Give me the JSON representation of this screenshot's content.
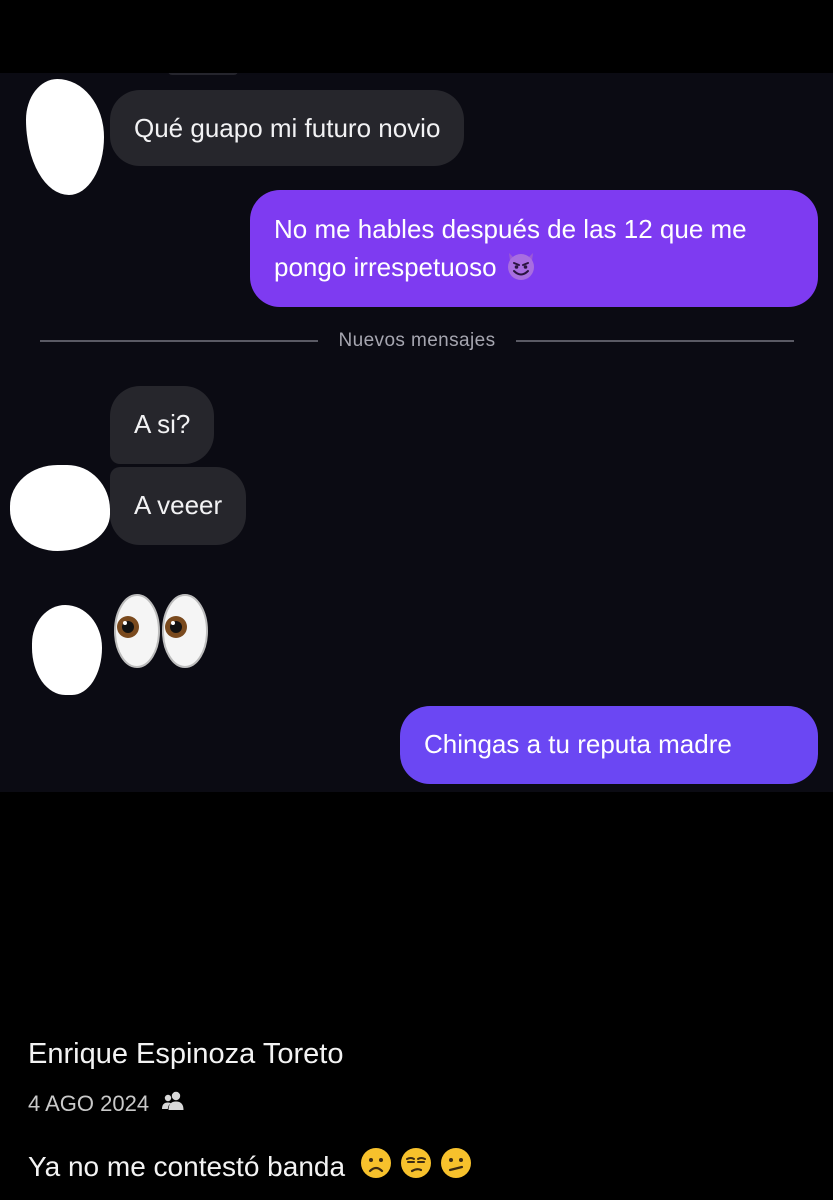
{
  "chat": {
    "messages": [
      {
        "from": "them",
        "text": "Qué guapo mi futuro novio"
      },
      {
        "from": "me",
        "text": "No me hables después de las 12 que me pongo irrespetuoso",
        "emoji": "smiling-imp"
      },
      {
        "from": "them",
        "text": "A si?"
      },
      {
        "from": "them",
        "text": "A veeer"
      },
      {
        "from": "them",
        "emoji": "eyes"
      },
      {
        "from": "me",
        "text": "Chingas a tu reputa madre"
      }
    ],
    "divider_label": "Nuevos mensajes",
    "colors": {
      "background": "#0b0b13",
      "incoming_bubble": "#26262c",
      "outgoing_bubble": "#7e3bf1",
      "outgoing_bubble_last": "#6b47f3"
    }
  },
  "post": {
    "author": "Enrique Espinoza Toreto",
    "date": "4 AGO 2024",
    "audience_icon": "friends-icon",
    "caption": "Ya no me contestó banda",
    "caption_emojis": [
      "frowning-face",
      "unamused-face",
      "confused-face"
    ]
  }
}
